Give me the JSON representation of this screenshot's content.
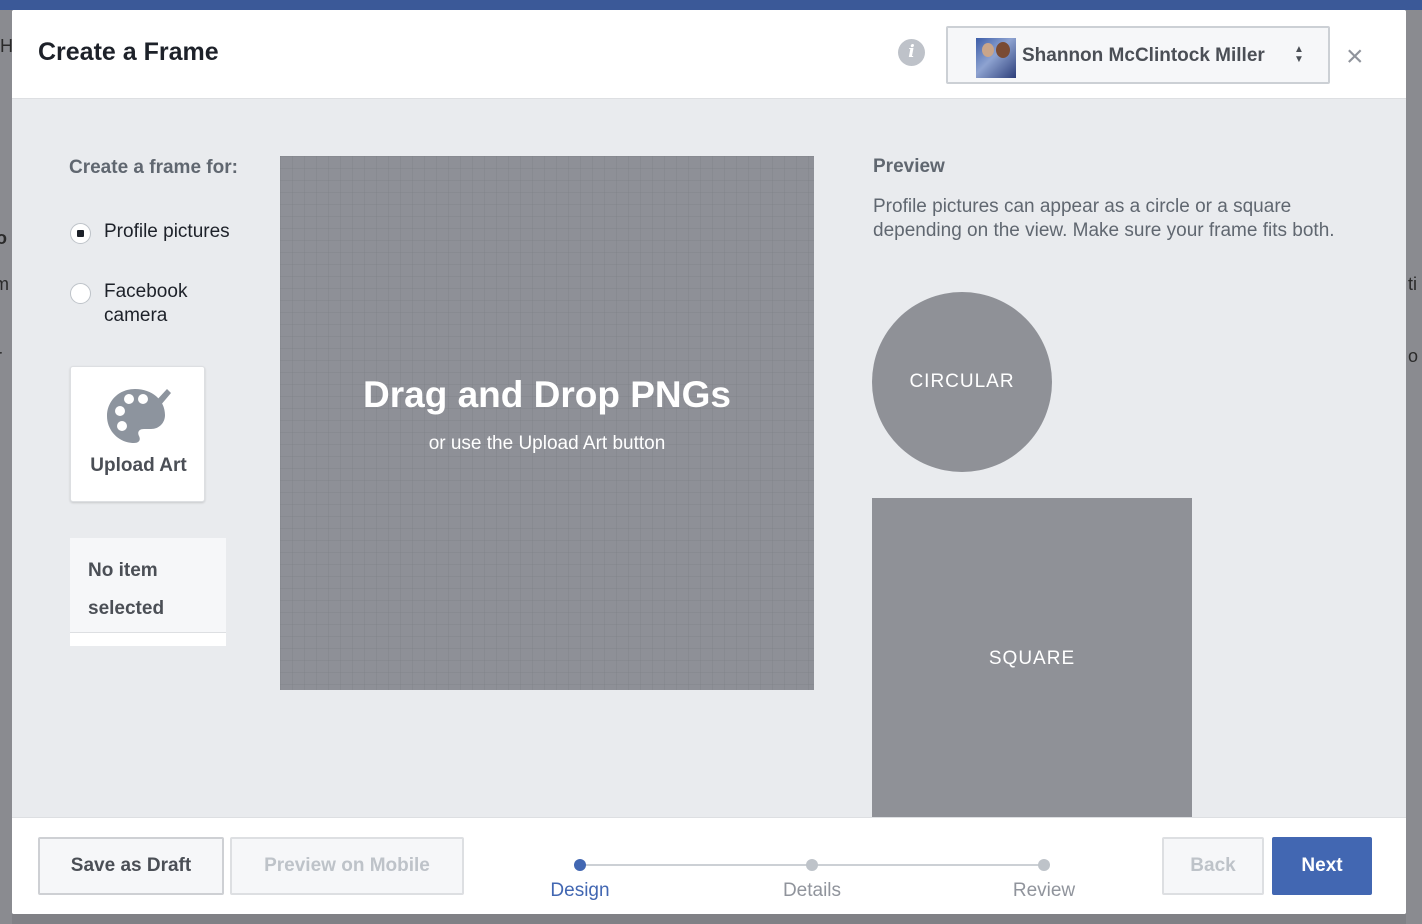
{
  "background": {
    "left_glyphs": [
      "H",
      "o",
      "m",
      "r"
    ],
    "right_glyphs": [
      "ti",
      "o"
    ]
  },
  "dialog": {
    "title": "Create a Frame",
    "account": {
      "name": "Shannon McClintock Miller",
      "caret": "▲▼"
    },
    "close": "×",
    "info": "i"
  },
  "frame_for": {
    "label": "Create a frame for:",
    "options": [
      {
        "label": "Profile pictures",
        "selected": true
      },
      {
        "label": "Facebook camera",
        "selected": false
      }
    ]
  },
  "upload": {
    "label": "Upload Art",
    "icon": "palette-icon"
  },
  "selection": {
    "text": "No item selected"
  },
  "canvas": {
    "title": "Drag and Drop PNGs",
    "subtitle": "or use the Upload Art button"
  },
  "preview": {
    "title": "Preview",
    "description": "Profile pictures can appear as a circle or a square depending on the view. Make sure your frame fits both.",
    "circular_label": "CIRCULAR",
    "square_label": "SQUARE"
  },
  "footer": {
    "save_draft": "Save as Draft",
    "preview_mobile": "Preview on Mobile",
    "back": "Back",
    "next": "Next",
    "steps": [
      {
        "label": "Design",
        "active": true
      },
      {
        "label": "Details",
        "active": false
      },
      {
        "label": "Review",
        "active": false
      }
    ]
  },
  "colors": {
    "brand": "#4267b2",
    "top_bar": "#3b5998"
  }
}
